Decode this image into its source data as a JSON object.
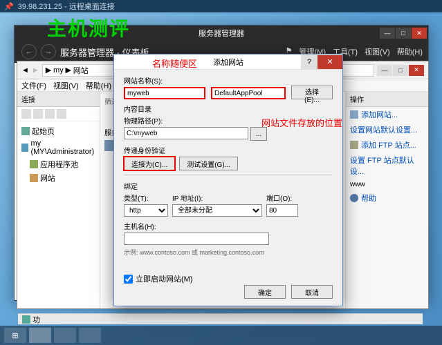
{
  "rdp": {
    "ip": "39.98.231.25 - 远程桌面连接"
  },
  "watermark": "主机测评",
  "annotations": {
    "name_hint": "名称随便区",
    "path_hint": "网站文件存放的位置"
  },
  "server_manager": {
    "title": "服务器管理器",
    "breadcrumb": "服务器管理器 · 仪表板",
    "menus": {
      "manage": "管理(M)",
      "tools": "工具(T)",
      "view": "视图(V)",
      "help": "帮助(H)"
    }
  },
  "iis": {
    "addr_parts": {
      "sep": "▶",
      "my": "my",
      "sites": "网站"
    },
    "menu": {
      "file": "文件(F)",
      "view": "视图(V)",
      "help": "帮助(H)"
    },
    "left": {
      "header": "连接",
      "root": "起始页",
      "server": "my (MY\\Administrator)",
      "apppools": "应用程序池",
      "sites": "网站"
    },
    "mid": {
      "shorthdr": "筛选",
      "srvlabel": "服务"
    },
    "right": {
      "header": "操作",
      "add_site": "添加网站...",
      "set_default": "设置网站默认设置...",
      "add_ftp": "添加 FTP 站点...",
      "set_ftp_default": "设置 FTP 站点默认设...",
      "www": "www",
      "help": "帮助"
    }
  },
  "dialog": {
    "title": "添加网站",
    "site_name_label": "网站名称(S):",
    "site_name_value": "myweb",
    "app_pool_value": "DefaultAppPool",
    "select_btn": "选择(E)...",
    "content_dir_hdr": "内容目录",
    "phys_path_label": "物理路径(P):",
    "phys_path_value": "C:\\myweb",
    "browse_btn": "...",
    "passthru_label": "传递身份验证",
    "connect_as_btn": "连接为(C)...",
    "test_settings_btn": "测试设置(G)...",
    "binding_hdr": "绑定",
    "type_label": "类型(T):",
    "type_value": "http",
    "ip_label": "IP 地址(I):",
    "ip_value": "全部未分配",
    "port_label": "端口(O):",
    "port_value": "80",
    "host_label": "主机名(H):",
    "host_value": "",
    "example": "示例: www.contoso.com 或 marketing.contoso.com",
    "start_chk": "立即启动网站(M)",
    "ok": "确定",
    "cancel": "取消"
  },
  "status": "功",
  "taskbar_start": "⊞"
}
